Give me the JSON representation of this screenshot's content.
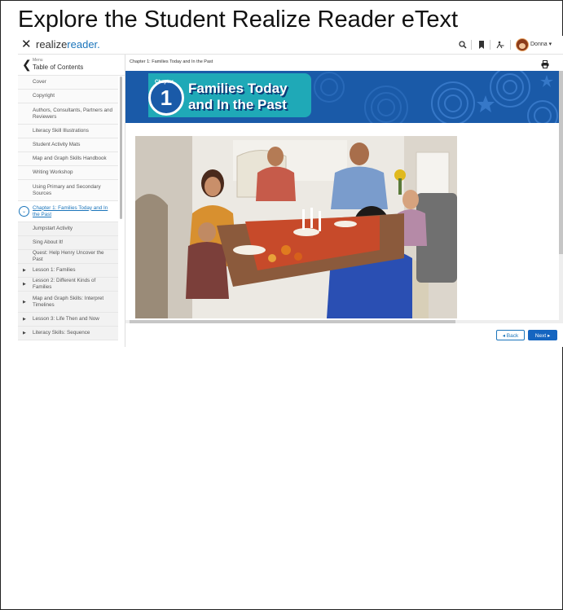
{
  "slide": {
    "title": "Explore the Student Realize Reader eText"
  },
  "topbar": {
    "close_glyph": "✕",
    "logo_prefix": "realize",
    "logo_suffix": "reader.",
    "icons": [
      "search-icon",
      "bookmark-icon",
      "accessibility-icon"
    ],
    "user_name": "Donna ▾"
  },
  "sidebar": {
    "back_glyph": "❮",
    "menu_label": "Menu",
    "title": "Table of Contents",
    "items": [
      {
        "label": "Cover"
      },
      {
        "label": "Copyright"
      },
      {
        "label": "Authors, Consultants, Partners and Reviewers"
      },
      {
        "label": "Literacy Skill Illustrations"
      },
      {
        "label": "Student Activity Mats"
      },
      {
        "label": "Map and Graph Skills Handbook"
      },
      {
        "label": "Writing Workshop"
      },
      {
        "label": "Using Primary and Secondary Sources"
      },
      {
        "label": "Chapter 1: Families Today and In the Past",
        "active": true
      },
      {
        "label": "Jumpstart Activity"
      },
      {
        "label": "Sing About It!"
      },
      {
        "label": "Quest: Help Henry Uncover the Past"
      },
      {
        "label": "Lesson 1: Families",
        "expandable": true
      },
      {
        "label": "Lesson 2: Different Kinds of Families",
        "expandable": true
      },
      {
        "label": "Map and Graph Skills: Interpret Timelines",
        "expandable": true
      },
      {
        "label": "Lesson 3: Life Then and Now",
        "expandable": true
      },
      {
        "label": "Literacy Skills: Sequence",
        "expandable": true
      }
    ]
  },
  "content": {
    "breadcrumb": "Chapter 1: Families Today and In the Past",
    "banner": {
      "chapter_label": "Chapter",
      "chapter_number": "1",
      "title_line1": "Families Today",
      "title_line2": "and In the Past"
    },
    "photo_description": "family-dinner-photo",
    "back_label": "◂ Back",
    "next_label": "Next ▸"
  },
  "colors": {
    "brand_blue": "#1b75bb",
    "banner_blue": "#1a5aa8",
    "banner_teal": "#1fa9b7",
    "next_button": "#1565c0"
  }
}
